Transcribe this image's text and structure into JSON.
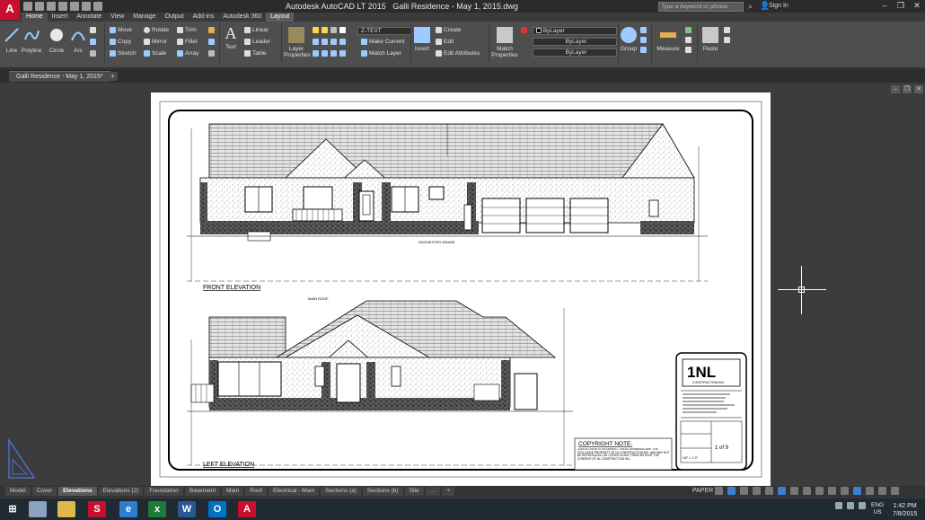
{
  "titlebar": {
    "app_name": "Autodesk AutoCAD LT 2015",
    "document": "Galli Residence - May 1, 2015.dwg",
    "search_placeholder": "Type a keyword or phrase",
    "signin": "Sign In"
  },
  "app_logo": "A",
  "ribbon_tabs": [
    "Home",
    "Insert",
    "Annotate",
    "View",
    "Manage",
    "Output",
    "Add-ins",
    "Autodesk 360",
    "Layout"
  ],
  "ribbon": {
    "draw": {
      "line": "Line",
      "polyline": "Polyline",
      "circle": "Circle",
      "arc": "Arc"
    },
    "modify": {
      "move": "Move",
      "rotate": "Rotate",
      "trim": "Trim",
      "copy": "Copy",
      "mirror": "Mirror",
      "fillet": "Fillet",
      "stretch": "Stretch",
      "scale": "Scale",
      "array": "Array"
    },
    "annotation": {
      "text": "Text",
      "linear": "Linear",
      "leader": "Leader",
      "table": "Table"
    },
    "layers": {
      "layer_properties": "Layer Properties",
      "current_layer": "Z-TEXT",
      "make_current": "Make Current",
      "match_layer": "Match Layer"
    },
    "block": {
      "insert": "Insert",
      "create": "Create",
      "edit": "Edit",
      "edit_attributes": "Edit Attributes"
    },
    "properties": {
      "match_properties": "Match Properties",
      "color": "ByLayer",
      "linetype": "ByLayer",
      "lineweight": "ByLayer"
    },
    "groups": {
      "group": "Group"
    },
    "utilities": {
      "measure": "Measure"
    },
    "clipboard": {
      "paste": "Paste"
    }
  },
  "file_tab": "Galli Residence - May 1, 2015*",
  "drawing": {
    "front_label": "FRONT ELEVATION",
    "left_label": "LEFT ELEVATION",
    "copyright_title": "COPYRIGHT NOTE:",
    "copyright_text": "2015 ALL RIGHTS RESERVED. THESE DRAWINGS ARE THE EXCLUSIVE PROPERTY OF NL CONSTRUCTION INC. AND MAY NOT BE REPRODUCED OR COPIED IN ANY FORM WITHOUT THE CONSENT OF NL CONSTRUCTION INC.",
    "logo_text": "1NL",
    "logo_sub": "CONSTRUCTION INC.",
    "sheet_number": "1 of 9",
    "scale": "1/8\" = 1'-0\"",
    "suggested_grade": "SUGGESTED GRADE",
    "main_roof": "MAIN ROOF"
  },
  "layout_tabs": [
    "Model",
    "Cover",
    "Elevations",
    "Elevations (2)",
    "Foundation",
    "Basement",
    "Main",
    "Roof",
    "Electrical - Main",
    "Sections (a)",
    "Sections (b)",
    "Site"
  ],
  "active_layout": "Elevations",
  "status": {
    "paper": "PAPER"
  },
  "taskbar": {
    "lang": "ENG",
    "region": "US",
    "time": "1:42 PM",
    "date": "7/8/2015"
  }
}
